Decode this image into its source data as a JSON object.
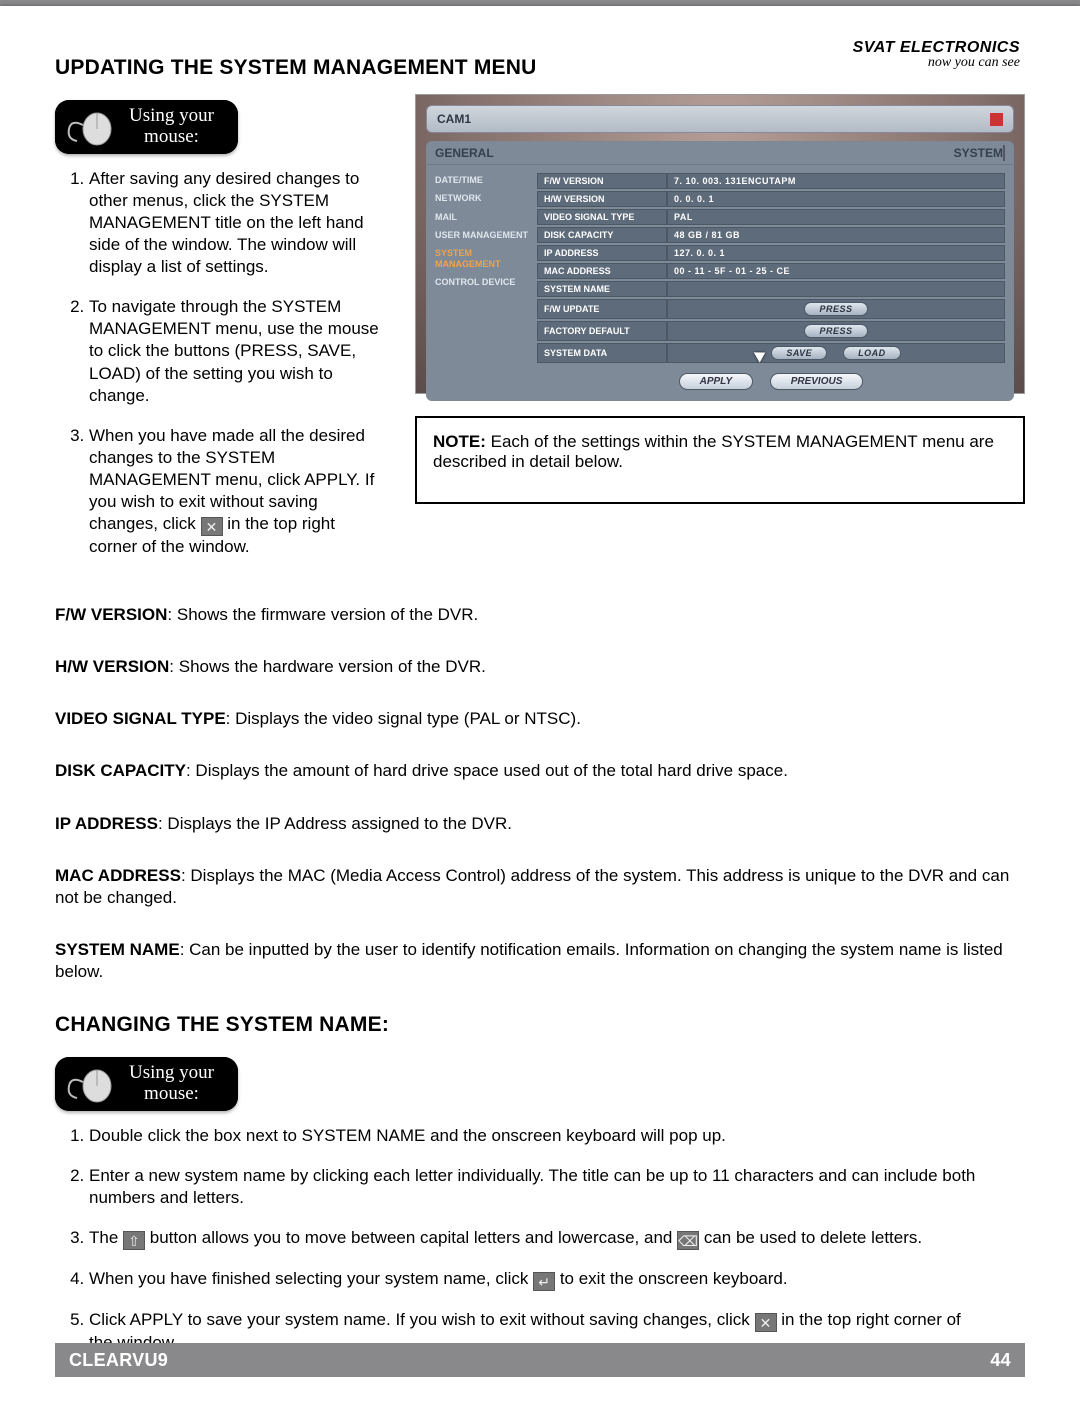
{
  "brand": {
    "name": "SVAT ELECTRONICS",
    "tag": "now you can see"
  },
  "heading1": "UPDATING THE SYSTEM MANAGEMENT MENU",
  "mouse_label_l1": "Using your",
  "mouse_label_l2": "mouse:",
  "steps1": [
    "After saving any desired changes to other menus, click the SYSTEM MANAGEMENT title on the left hand side of the window.  The window will display a list of settings.",
    "To navigate through the SYSTEM MANAGEMENT menu, use the mouse to click the buttons (PRESS, SAVE, LOAD) of the setting you wish to change.",
    "When you have made all the desired changes to the SYSTEM MANAGEMENT menu, click APPLY.  If you wish to exit without saving changes, click ",
    " in the top right corner of the window."
  ],
  "shot": {
    "cam": "CAM1",
    "general": "GENERAL",
    "system": "SYSTEM",
    "nav": [
      "DATE/TIME",
      "NETWORK",
      "MAIL",
      "USER MANAGEMENT",
      "SYSTEM MANAGEMENT",
      "CONTROL DEVICE"
    ],
    "rows": [
      {
        "l": "F/W VERSION",
        "v": "7. 10. 003. 131ENCUTAPM"
      },
      {
        "l": "H/W VERSION",
        "v": "0. 0. 0. 1"
      },
      {
        "l": "VIDEO SIGNAL TYPE",
        "v": "PAL"
      },
      {
        "l": "DISK CAPACITY",
        "v": "48 GB  /  81 GB"
      },
      {
        "l": "IP ADDRESS",
        "v": "127. 0. 0. 1"
      },
      {
        "l": "MAC ADDRESS",
        "v": "00 - 11 - 5F - 01 - 25 - CE"
      },
      {
        "l": "SYSTEM NAME",
        "v": ""
      },
      {
        "l": "F/W UPDATE",
        "btn": [
          "PRESS"
        ]
      },
      {
        "l": "FACTORY DEFAULT",
        "btn": [
          "PRESS"
        ]
      },
      {
        "l": "SYSTEM DATA",
        "btn": [
          "SAVE",
          "LOAD"
        ]
      }
    ],
    "apply": "APPLY",
    "previous": "PREVIOUS"
  },
  "note_label": "NOTE:",
  "note_text": " Each of the settings within the SYSTEM MANAGEMENT menu are described in detail below.",
  "defs": [
    {
      "t": "F/W VERSION",
      "d": ":  Shows the firmware version of the DVR."
    },
    {
      "t": "H/W VERSION",
      "d": ":  Shows the hardware version of the DVR."
    },
    {
      "t": "VIDEO SIGNAL TYPE",
      "d": ":  Displays the video signal type (PAL or NTSC)."
    },
    {
      "t": "DISK CAPACITY",
      "d": ":  Displays the amount of hard drive space used out of the total hard drive space."
    },
    {
      "t": "IP ADDRESS",
      "d": ":  Displays the IP Address assigned to the DVR."
    },
    {
      "t": "MAC ADDRESS",
      "d": ":  Displays the MAC (Media Access Control) address of the system.  This address is unique to the DVR and can not be changed."
    },
    {
      "t": "SYSTEM NAME",
      "d": ":  Can be inputted by the user to identify notification emails.  Information on changing the system name is listed below."
    }
  ],
  "heading2": "CHANGING THE SYSTEM NAME:",
  "steps2": [
    "Double click the box next to SYSTEM NAME and the onscreen keyboard will pop up.",
    "Enter a new system name by clicking each letter individually.  The title can be up to 11 characters and can include both numbers and letters.",
    "The ",
    " button allows you to move between capital letters and lowercase, and ",
    " can be used to delete letters.",
    "When you have finished selecting your system name, click ",
    " to exit the onscreen keyboard.",
    "Click APPLY to save your system name.  If you wish to exit without saving changes, click ",
    " in the top right corner of the window."
  ],
  "footer": {
    "model": "CLEARVU9",
    "page": "44"
  }
}
